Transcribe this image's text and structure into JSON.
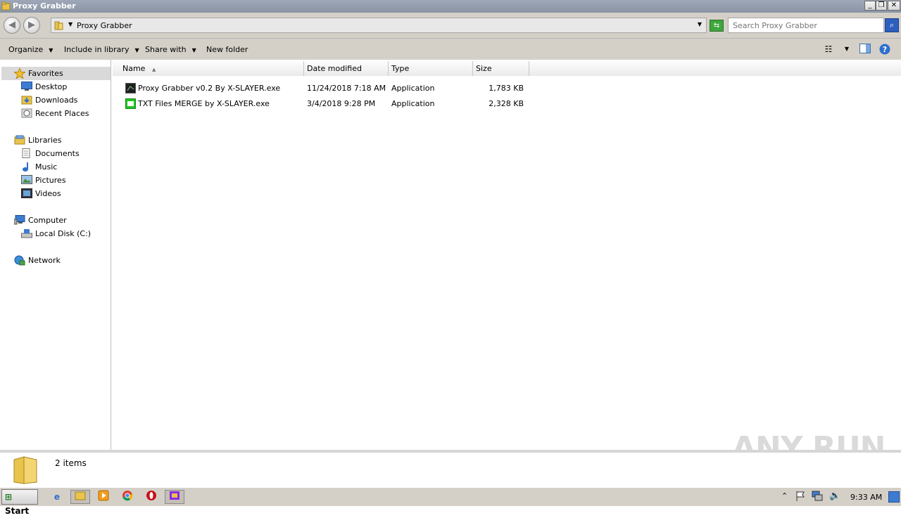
{
  "window": {
    "title": "Proxy Grabber"
  },
  "address": {
    "path": "Proxy Grabber",
    "search_placeholder": "Search Proxy Grabber"
  },
  "toolbar": {
    "organize": "Organize",
    "include": "Include in library",
    "share": "Share with",
    "newfolder": "New folder"
  },
  "nav": {
    "favorites": "Favorites",
    "desktop": "Desktop",
    "downloads": "Downloads",
    "recent": "Recent Places",
    "libraries": "Libraries",
    "documents": "Documents",
    "music": "Music",
    "pictures": "Pictures",
    "videos": "Videos",
    "computer": "Computer",
    "localdisk": "Local Disk (C:)",
    "network": "Network"
  },
  "columns": {
    "name": "Name",
    "date": "Date modified",
    "type": "Type",
    "size": "Size"
  },
  "files": [
    {
      "name": "Proxy Grabber v0.2 By X-SLAYER.exe",
      "date": "11/24/2018 7:18 AM",
      "type": "Application",
      "size": "1,783 KB"
    },
    {
      "name": "TXT Files MERGE by X-SLAYER.exe",
      "date": "3/4/2018 9:28 PM",
      "type": "Application",
      "size": "2,328 KB"
    }
  ],
  "status": {
    "count": "2 items"
  },
  "taskbar": {
    "start": "Start",
    "clock": "9:33 AM"
  },
  "watermark": "ANY RUN",
  "icons": {
    "favorites": "star-icon",
    "desktop": "desktop-icon",
    "downloads": "downloads-folder-icon",
    "recent": "recent-places-icon",
    "libraries": "libraries-icon",
    "computer": "computer-icon",
    "network": "network-icon"
  }
}
